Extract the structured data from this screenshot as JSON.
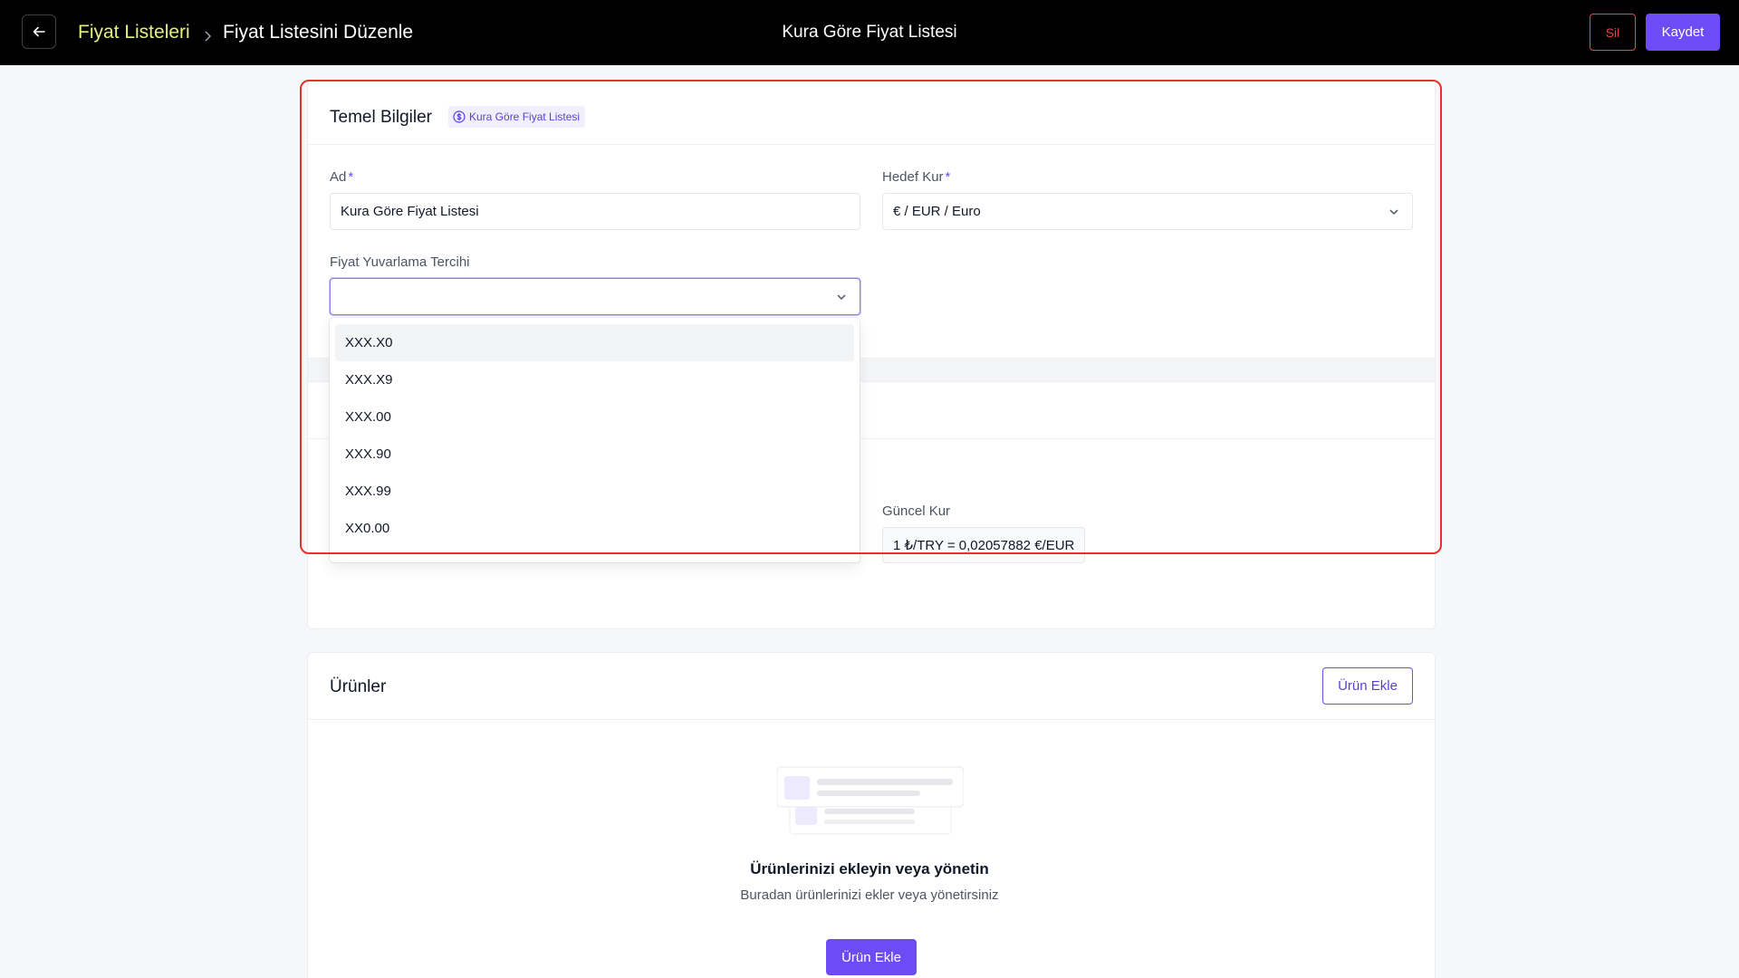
{
  "header": {
    "breadcrumb_parent": "Fiyat Listeleri",
    "breadcrumb_current": "Fiyat Listesini Düzenle",
    "page_title": "Kura Göre Fiyat Listesi",
    "delete_label": "Sil",
    "save_label": "Kaydet"
  },
  "basic_info": {
    "title": "Temel Bilgiler",
    "badge": "Kura Göre Fiyat Listesi",
    "name_label": "Ad",
    "name_value": "Kura Göre Fiyat Listesi",
    "target_currency_label": "Hedef Kur",
    "target_currency_value": "€ / EUR / Euro",
    "rounding_label": "Fiyat Yuvarlama Tercihi",
    "rounding_value": "",
    "rounding_options": [
      "XXX.X0",
      "XXX.X9",
      "XXX.00",
      "XXX.90",
      "XXX.99",
      "XX0.00"
    ],
    "current_rate_label": "Güncel Kur",
    "current_rate_value": "1 ₺/TRY = 0,02057882 €/EUR"
  },
  "products": {
    "title": "Ürünler",
    "add_label": "Ürün Ekle",
    "empty_title": "Ürünlerinizi ekleyin veya yönetin",
    "empty_subtitle": "Buradan ürünlerinizi ekler veya yönetirsiniz",
    "empty_add_label": "Ürün Ekle"
  },
  "colors": {
    "accent": "#6d4cf5",
    "danger": "#ef4444",
    "breadcrumb_link": "#e6f07e",
    "highlight": "#e5322d"
  },
  "icons": {
    "back": "arrow-left-icon",
    "breadcrumb_separator": "chevron-right-icon",
    "badge": "currency-icon",
    "select_chevron": "chevron-down-icon"
  }
}
